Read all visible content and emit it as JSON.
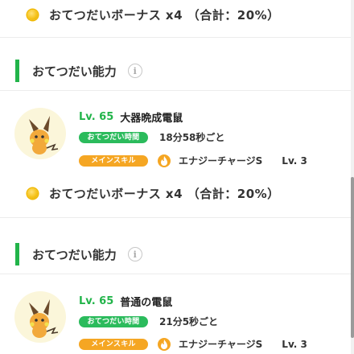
{
  "bonus_rows": [
    {
      "icon": "coin-icon",
      "text": "おてつだいボーナス x4 （合計：20%）"
    },
    {
      "icon": "coin-icon",
      "text": "おてつだいボーナス x4 （合計：20%）"
    }
  ],
  "sections": [
    {
      "title": "おてつだい能力",
      "info_icon": "i",
      "pokemon": {
        "level": "Lv. 65",
        "name": "大器晩成電鼠",
        "help_time_label": "おてつだい時間",
        "help_time_value": "18分58秒ごと",
        "main_skill_label": "メインスキル",
        "skill_icon": "flame-icon",
        "skill_name": "エナジーチャージS",
        "skill_level": "Lv. 3"
      }
    },
    {
      "title": "おてつだい能力",
      "info_icon": "i",
      "pokemon": {
        "level": "Lv. 65",
        "name": "普通の電鼠",
        "help_time_label": "おてつだい時間",
        "help_time_value": "21分5秒ごと",
        "main_skill_label": "メインスキル",
        "skill_icon": "flame-icon",
        "skill_name": "エナジーチャージS",
        "skill_level": "Lv. 3"
      }
    }
  ],
  "colors": {
    "accent_green": "#22b44a",
    "pill_green": "#2bbb5c",
    "pill_orange": "#f5a623",
    "coin_gold": "#f6c31c",
    "avatar_bg": "#fbf6da"
  }
}
